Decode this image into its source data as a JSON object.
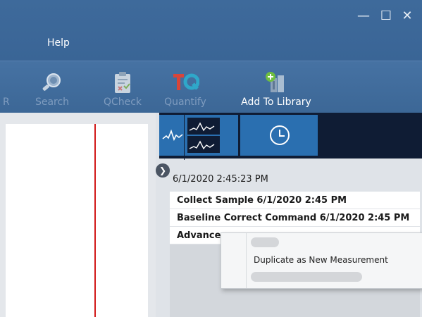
{
  "window": {
    "minimize_glyph": "—",
    "maximize_glyph": "☐",
    "close_glyph": "✕"
  },
  "menu": {
    "help_label": "Help"
  },
  "toolbar": {
    "partial_label": "R",
    "items": [
      {
        "label": "Search",
        "enabled": false,
        "icon": "search-icon"
      },
      {
        "label": "QCheck",
        "enabled": false,
        "icon": "qcheck-icon"
      },
      {
        "label": "Quantify",
        "enabled": false,
        "icon": "quantify-icon"
      },
      {
        "label": "Add To Library",
        "enabled": true,
        "icon": "add-to-library-icon"
      }
    ]
  },
  "history": {
    "timestamp": "6/1/2020 2:45:23 PM",
    "rows": [
      "Collect Sample  6/1/2020 2:45 PM",
      "Baseline Correct Command  6/1/2020 2:45 PM",
      "Advance"
    ]
  },
  "context_menu": {
    "item": "Duplicate as New Measurement"
  },
  "colors": {
    "titlebar": "#3a6596",
    "tab_bar": "#0f1c34",
    "tab_active": "#2a6fb0",
    "plot_line": "#d11a1a"
  }
}
